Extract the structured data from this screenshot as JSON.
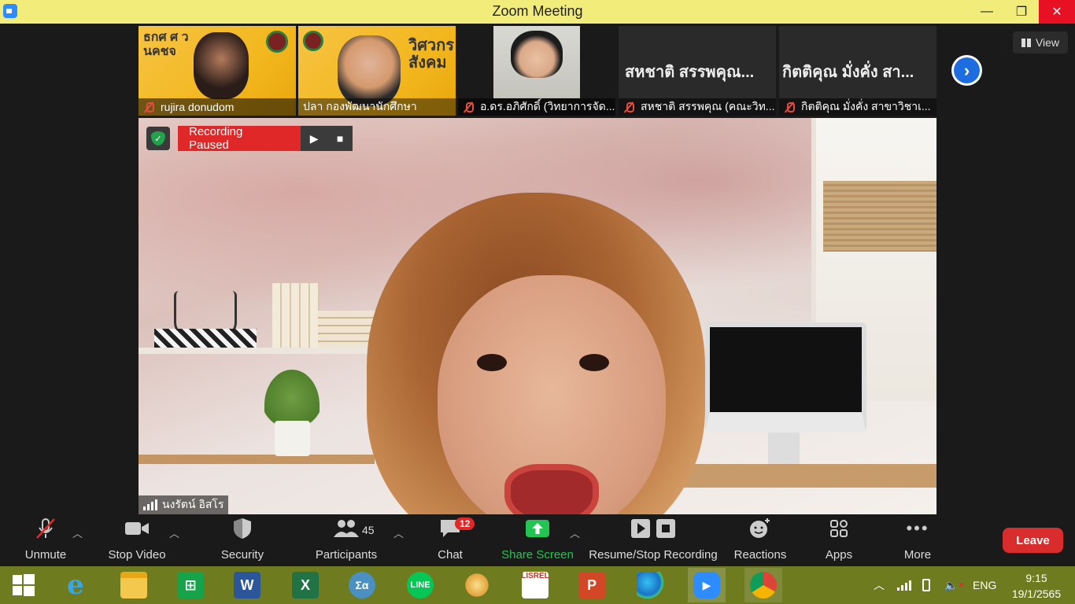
{
  "window": {
    "title": "Zoom Meeting",
    "minimize": "—",
    "restore": "❐",
    "close": "✕"
  },
  "thumbnails": [
    {
      "name": "rujira donudom",
      "poster_text": "ธกศ ศ ว นคชจ"
    },
    {
      "name": "ปลา กองพัฒนานักศึกษา",
      "poster_text": "วิศวกร สังคม"
    },
    {
      "name": "อ.ดร.อภิศักดิ์ (วิทยาการจัด..."
    },
    {
      "name": "สหชาติ สรรพคุณ (คณะวิท...",
      "big_name": "สหชาติ สรรพคุณ..."
    },
    {
      "name": "กิตติคุณ  มั่งคั่ง สาขาวิชาเ...",
      "big_name": "กิตติคุณ  มั่งคั่ง สา..."
    }
  ],
  "view_button": "View",
  "recording": {
    "status": "Recording Paused",
    "play": "▶",
    "stop": "■"
  },
  "speaker": {
    "name": "นงรัตน์ อิสโร"
  },
  "toolbar": {
    "unmute": "Unmute",
    "stop_video": "Stop Video",
    "security": "Security",
    "participants": "Participants",
    "participants_count": "45",
    "chat": "Chat",
    "chat_badge": "12",
    "share_screen": "Share Screen",
    "resume_stop_recording": "Resume/Stop Recording",
    "reactions": "Reactions",
    "apps": "Apps",
    "more": "More",
    "leave": "Leave"
  },
  "taskbar": {
    "lang": "ENG",
    "time": "9:15",
    "date": "19/1/2565",
    "apps": [
      "start",
      "internet-explorer",
      "file-explorer",
      "store",
      "word",
      "excel",
      "math",
      "line",
      "paint",
      "lisrel",
      "powerpoint",
      "edge",
      "zoom",
      "chrome"
    ]
  },
  "colors": {
    "title_bar": "#f2ec7a",
    "share_green": "#23c552",
    "leave_red": "#d92d2d",
    "taskbar": "#6e7b1f"
  }
}
